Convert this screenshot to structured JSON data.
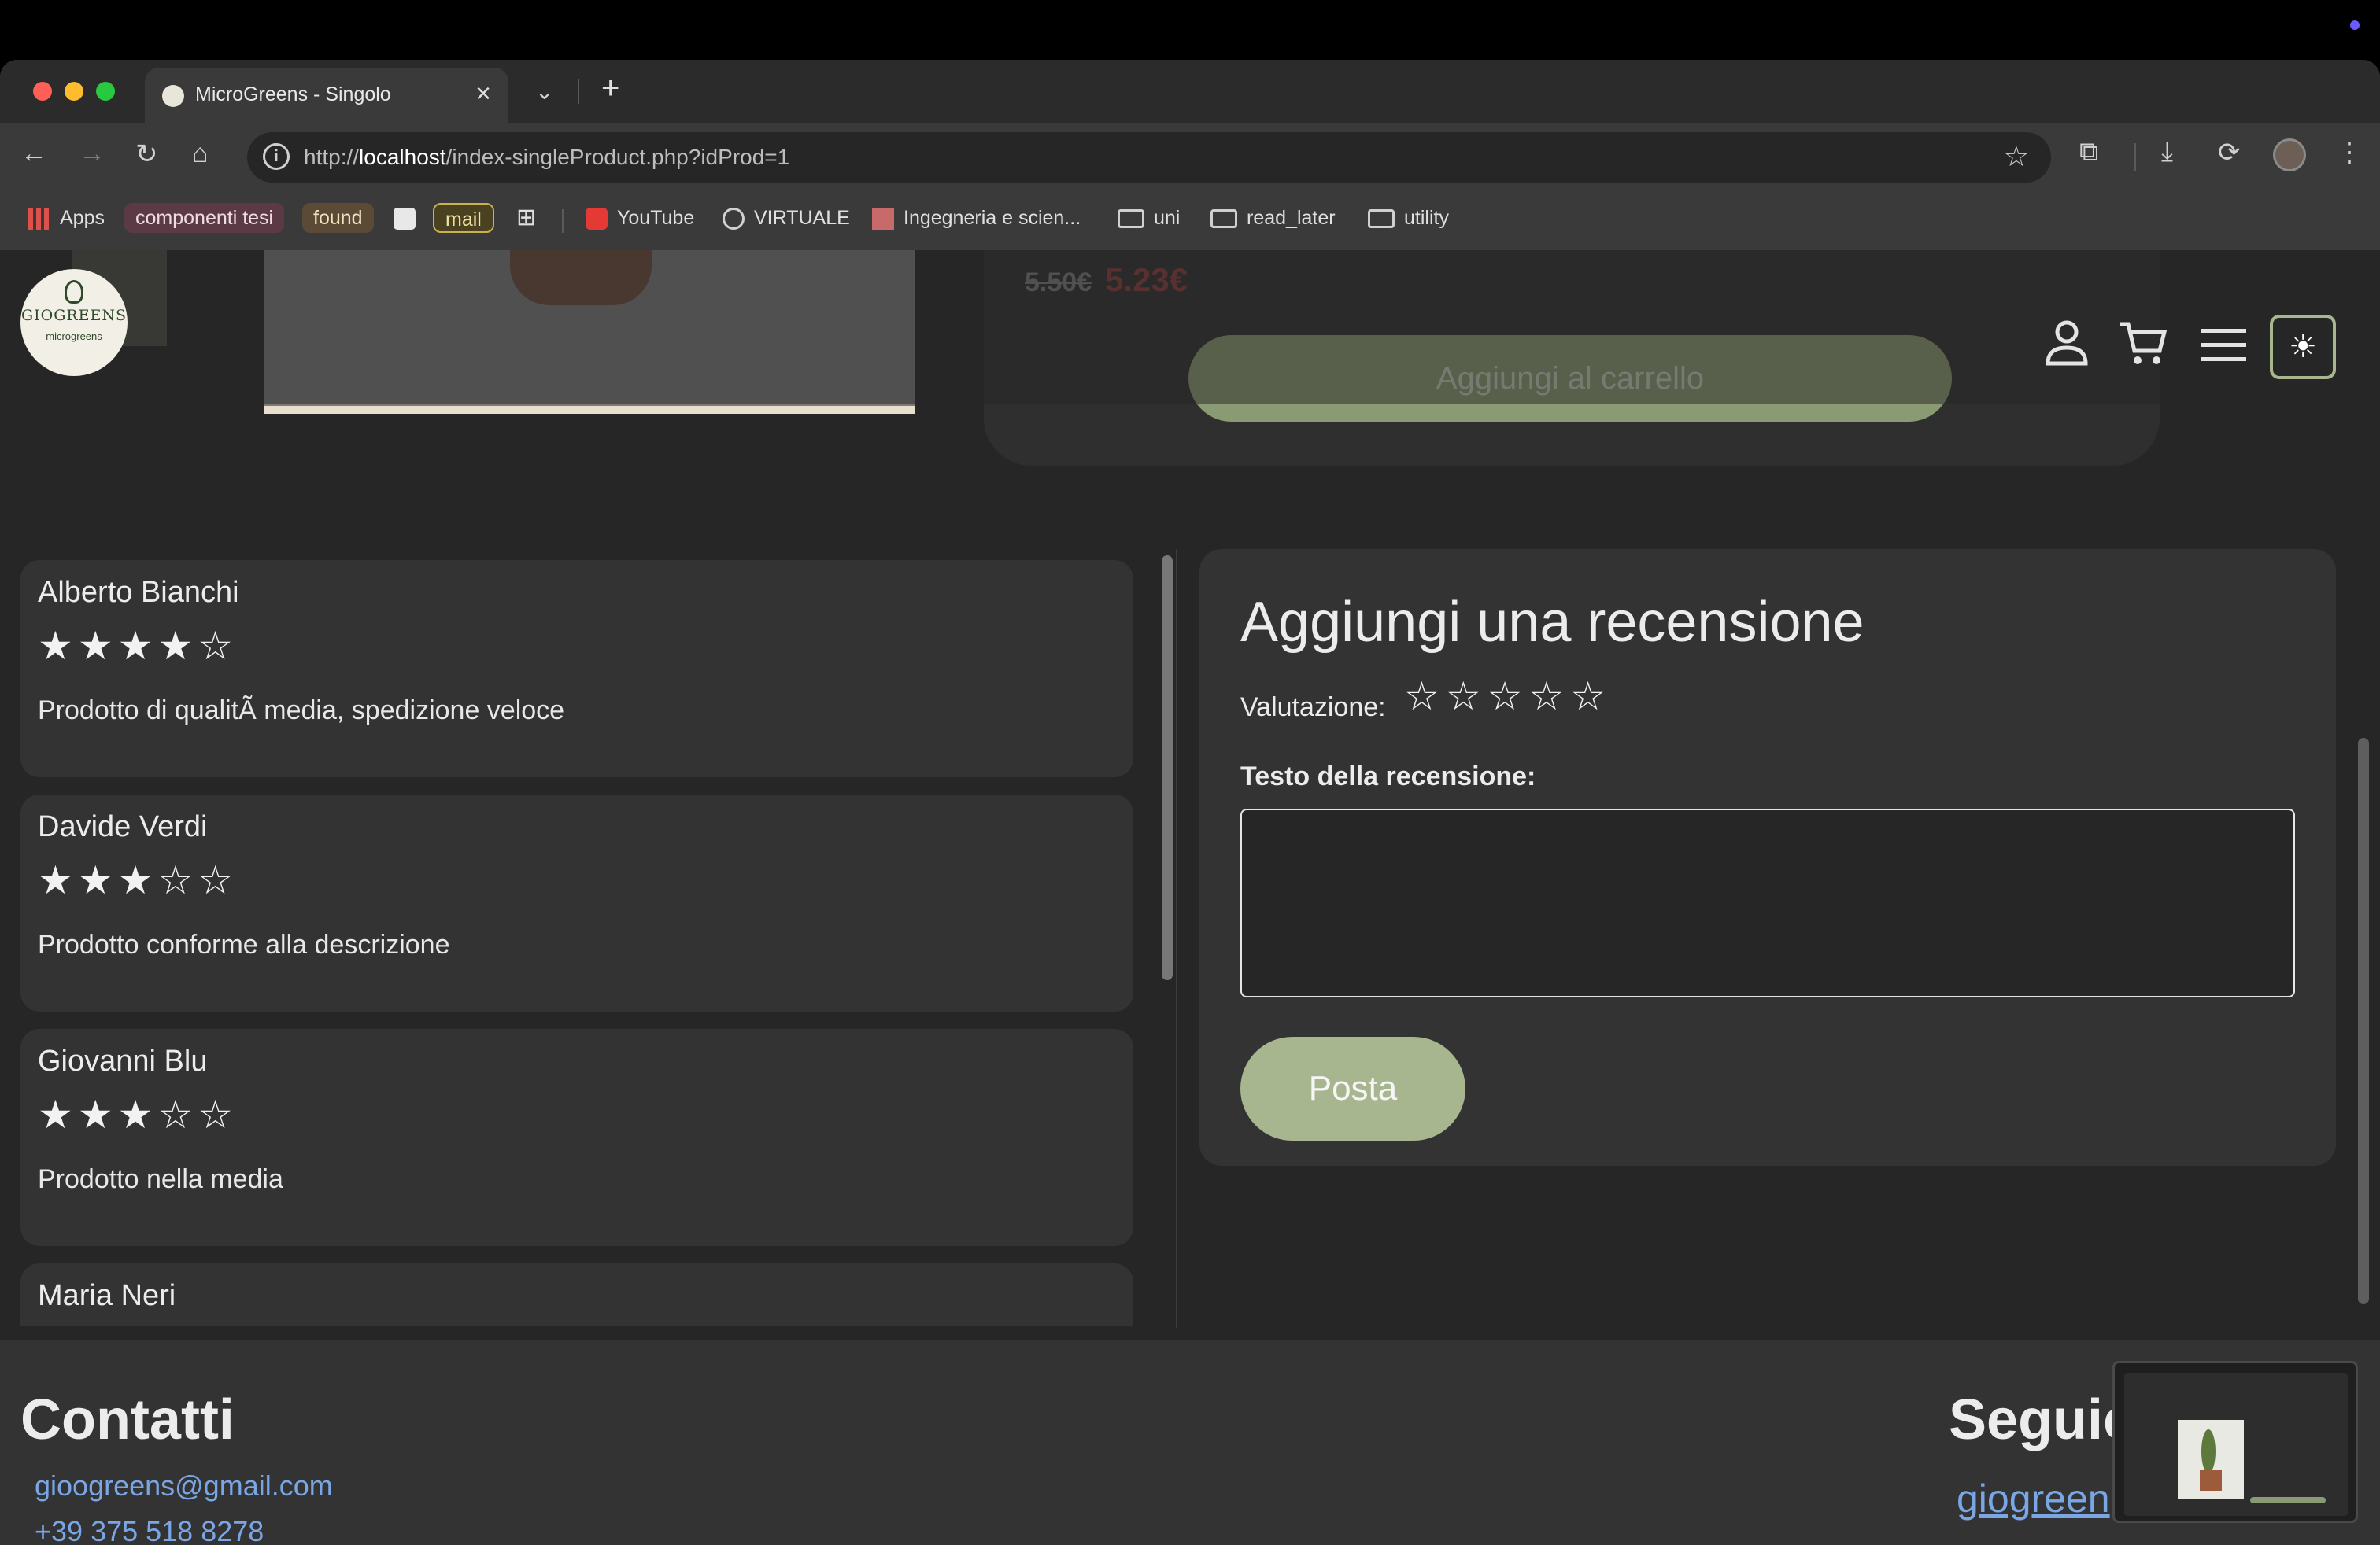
{
  "browser": {
    "tab_title": "MicroGreens - Singolo",
    "url_prefix": "http://",
    "url_host": "localhost",
    "url_path": "/index-singleProduct.php?idProd=1",
    "bookmarks": [
      {
        "label": "Apps"
      },
      {
        "label": "componenti tesi"
      },
      {
        "label": "found"
      },
      {
        "label": "mail"
      },
      {
        "label": "YouTube"
      },
      {
        "label": "VIRTUALE"
      },
      {
        "label": "Ingegneria e scien..."
      },
      {
        "label": "uni"
      },
      {
        "label": "read_later"
      },
      {
        "label": "utility"
      }
    ]
  },
  "header": {
    "logo_text": "GIOGREENS",
    "logo_sub": "microgreens"
  },
  "product": {
    "price_old": "5.50€",
    "price_new": "5.23€",
    "add_to_cart": "Aggiungi al carrello"
  },
  "reviews": [
    {
      "name": "Alberto Bianchi",
      "rating": 4,
      "stars": "★★★★☆",
      "text": "Prodotto di qualitÃ  media, spedizione veloce"
    },
    {
      "name": "Davide Verdi",
      "rating": 3,
      "stars": "★★★☆☆",
      "text": "Prodotto conforme alla descrizione"
    },
    {
      "name": "Giovanni Blu",
      "rating": 3,
      "stars": "★★★☆☆",
      "text": "Prodotto nella media"
    },
    {
      "name": "Maria Neri",
      "rating": null,
      "stars": "",
      "text": ""
    }
  ],
  "add_review": {
    "title": "Aggiungi una recensione",
    "rating_label": "Valutazione:",
    "rating_stars": "☆☆☆☆☆",
    "text_label": "Testo della recensione:",
    "text_value": "",
    "post_label": "Posta"
  },
  "footer": {
    "contacts_title": "Contatti",
    "email": "gioogreens@gmail.com",
    "phone": "+39 375 518 8278",
    "follow_title": "Seguic",
    "social_handle": "giogreen"
  },
  "colors": {
    "accent": "#a7b68f",
    "link": "#7aa6e6",
    "page_bg": "#262626",
    "card_bg": "#333333"
  }
}
